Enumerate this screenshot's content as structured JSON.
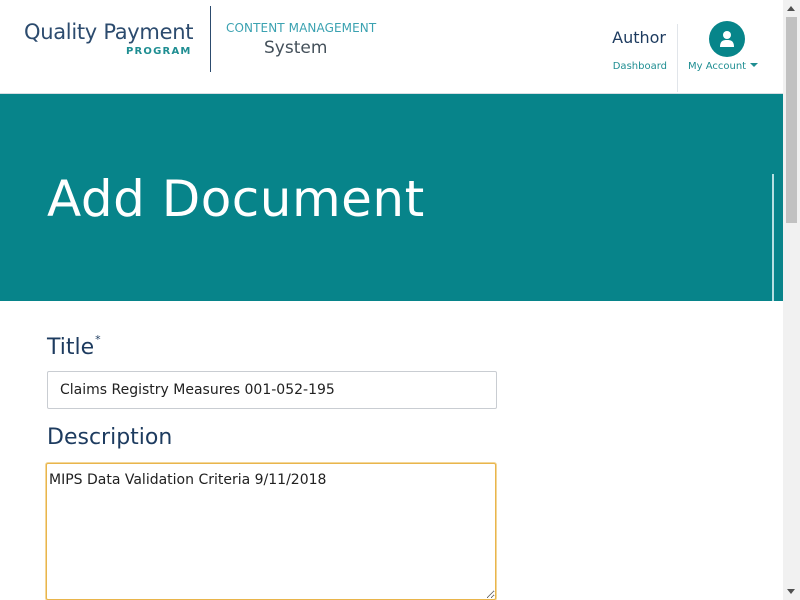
{
  "brand": {
    "qpp_main": "Quality Payment",
    "qpp_sub": "PROGRAM",
    "cms_top": "CONTENT MANAGEMENT",
    "cms_bottom": "System"
  },
  "user": {
    "role": "Author",
    "dashboard_label": "Dashboard",
    "account_label": "My Account",
    "avatar_icon": "user-icon"
  },
  "banner": {
    "title": "Add Document"
  },
  "form": {
    "title_label": "Title",
    "required_mark": "*",
    "title_value": "Claims Registry Measures 001-052-195",
    "description_label": "Description",
    "description_value": "MIPS Data Validation Criteria 9/11/2018"
  },
  "colors": {
    "accent": "#07848a",
    "navy": "#1d3b5f",
    "focus_border": "#e9b54b"
  }
}
